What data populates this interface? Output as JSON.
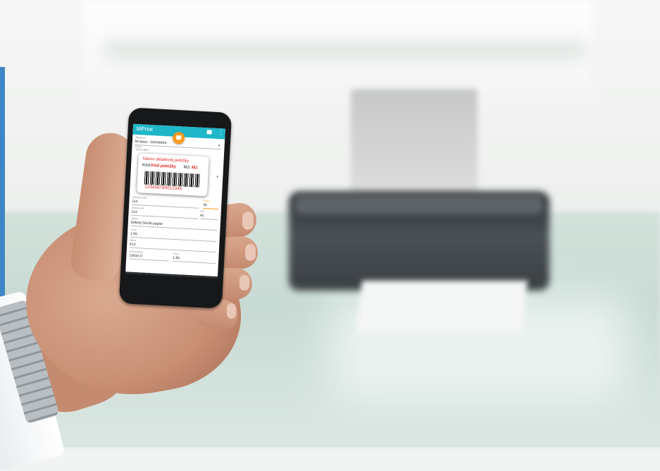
{
  "app": {
    "title": "MPrint",
    "actions": {
      "camera_icon": "camera-icon",
      "overflow_icon": "overflow-menu-icon",
      "print_icon": "print-icon"
    },
    "accent_colors": {
      "appbar": "#1fb6c9",
      "fab": "#ff9a1c",
      "label_red": "#e11b1b"
    }
  },
  "form": {
    "printer": {
      "label": "Tlačiareň",
      "value": "M-class - DATAMAX"
    },
    "label_template": {
      "label": "Štítok",
      "value": "90x35 BAR"
    },
    "preview": {
      "item_name": "Názov skladovej položky",
      "code_label": "Kód:",
      "code_value": "Kód položky",
      "unit_label": "MJ:",
      "unit_value": "MJ",
      "barcode_digits": "123456789012345"
    },
    "row1": {
      "left_label": "Skladový kód",
      "left_value": "114",
      "right_label": "Počet",
      "right_value": "25"
    },
    "row2": {
      "left_label": "Interný kód",
      "left_value": "114",
      "right_label": "MJ",
      "right_value": "ks"
    },
    "row3": {
      "label": "Názov",
      "value": "Etikety 50x30 papier"
    },
    "row4": {
      "label": "Cena",
      "value": "1.56"
    },
    "row5": {
      "label": "Mena",
      "value": "€12"
    },
    "row6": {
      "left_label": "Kód položky",
      "left_value": "13010.0",
      "right_label": "Cena",
      "right_value": "1.56"
    }
  }
}
